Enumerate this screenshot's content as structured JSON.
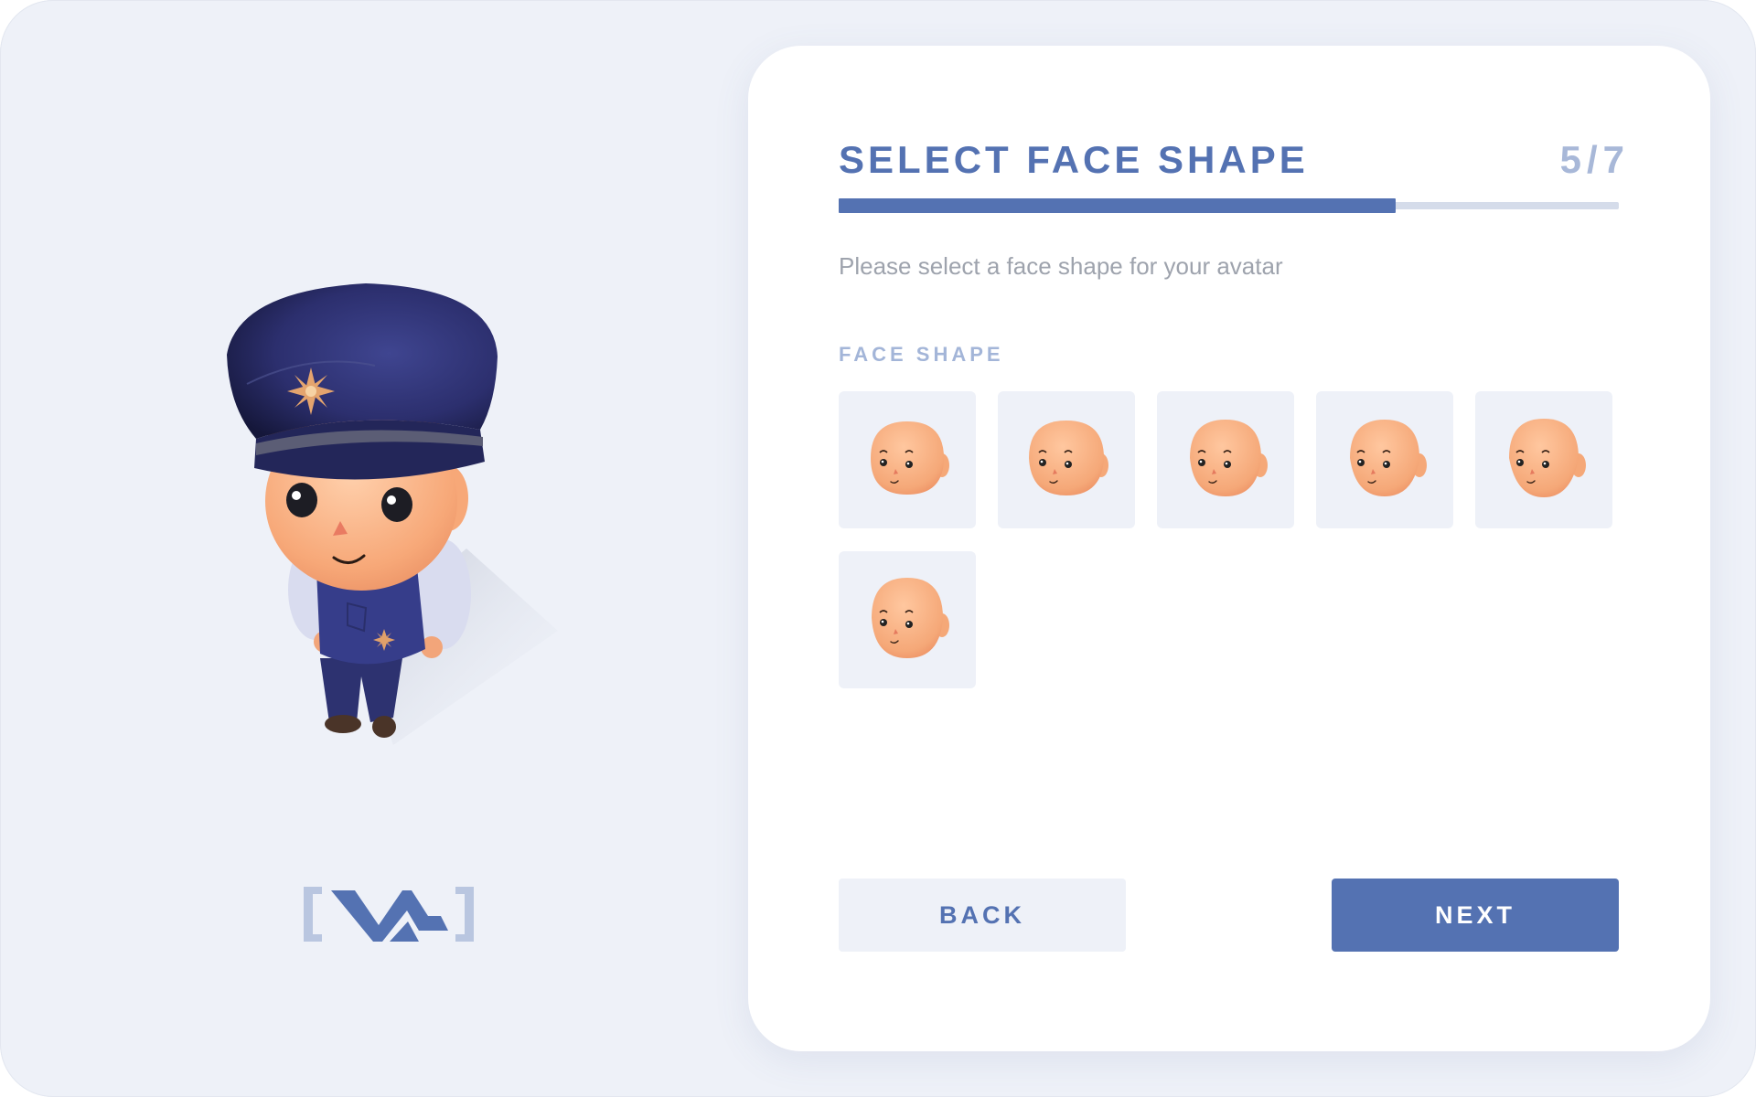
{
  "step": {
    "title": "SELECT FACE SHAPE",
    "counter": "5/7",
    "current": 5,
    "total": 7
  },
  "subtitle": "Please select a face shape for your avatar",
  "section_label": "FACE SHAPE",
  "face_options": [
    {
      "icon": "face-shape-1-icon"
    },
    {
      "icon": "face-shape-2-icon"
    },
    {
      "icon": "face-shape-3-icon"
    },
    {
      "icon": "face-shape-4-icon"
    },
    {
      "icon": "face-shape-5-icon"
    },
    {
      "icon": "face-shape-6-icon"
    }
  ],
  "buttons": {
    "back": "BACK",
    "next": "NEXT"
  },
  "colors": {
    "accent": "#5472b2",
    "background": "#eef1f8",
    "muted_accent": "#a8b8d8",
    "skin": "#f5a878"
  },
  "logo": {
    "icon": "brand-logo-icon"
  }
}
